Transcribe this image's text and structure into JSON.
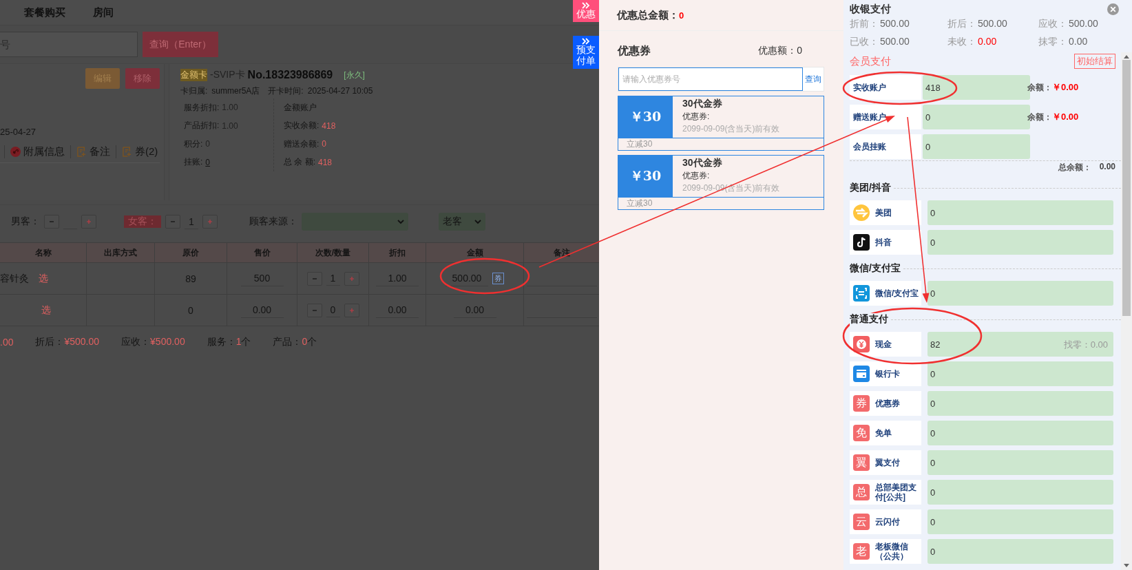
{
  "nav": {
    "items": [
      "套餐购买",
      "房间"
    ]
  },
  "search": {
    "placeholder": "号",
    "button": "查询（Enter）"
  },
  "customer_card": {
    "buttons": [
      "编辑",
      "移除"
    ],
    "date": "25-04-27",
    "links": [
      {
        "kind": "info",
        "label": "附属信息"
      },
      {
        "kind": "note",
        "label": "备注"
      },
      {
        "kind": "coupon",
        "label": "券(2)"
      }
    ]
  },
  "member_card": {
    "card_type": "金额卡",
    "card_name": "-SVIP卡",
    "card_no": "No.18323986869",
    "validity": "[永久]",
    "store_label": "卡归属:",
    "store": "summer5A店",
    "open_label": "开卡时间:",
    "open_time": "2025-04-27 10:05",
    "left": [
      {
        "kind": "plain",
        "label": "服务折扣:",
        "value": "1.00"
      },
      {
        "kind": "plain",
        "label": "产品折扣:",
        "value": "1.00"
      },
      {
        "kind": "plain",
        "label": "积分:",
        "value": "0"
      },
      {
        "kind": "link",
        "label": "挂账:",
        "value": "0"
      }
    ],
    "right_title": "金额账户",
    "right": [
      {
        "label": "实收余额:",
        "value": "418"
      },
      {
        "label": "赠送余额:",
        "value": "0"
      },
      {
        "label": "总 余 额:",
        "value": "418"
      }
    ]
  },
  "guests": {
    "male_label": "男客：",
    "female_label": "女客：",
    "female_count": "1",
    "source_label": "顾客来源：",
    "type_value": "老客"
  },
  "table": {
    "columns": [
      "名称",
      "出库方式",
      "原价",
      "售价",
      "次数/数量",
      "折扣",
      "金额",
      "备注"
    ],
    "rows": [
      {
        "name": "容针灸",
        "pick": "选",
        "original": "89",
        "price": "500",
        "qty": "1",
        "discount": "1.00",
        "amount": "500.00",
        "coupon": "券"
      },
      {
        "pick": "选",
        "original": "0",
        "price": "0.00",
        "qty": "0",
        "discount": "0.00",
        "amount": "0.00"
      }
    ]
  },
  "summary": [
    {
      "value": ".00"
    },
    {
      "label": "折后：",
      "value": "¥500.00"
    },
    {
      "label": "应收：",
      "value": "¥500.00"
    },
    {
      "label": "服务：",
      "value": "1",
      "unit": "个"
    },
    {
      "label": "产品：",
      "value": "0",
      "unit": "个"
    }
  ],
  "side_tabs": [
    {
      "label": "优惠",
      "color": "#ff4f7b"
    },
    {
      "label": "预支付单",
      "color": "#0a5cff"
    }
  ],
  "discount_total": {
    "label": "优惠总金额：",
    "value": "0"
  },
  "coupons": {
    "title": "优惠券",
    "amount_label": "优惠额：",
    "amount": "0",
    "placeholder": "请输入优惠券号",
    "query": "查询",
    "items": [
      {
        "price": "￥30",
        "name": "30代金券",
        "type": "优惠券:",
        "validity": "2099-09-09(含当天)前有效",
        "note": "立减30"
      },
      {
        "price": "￥30",
        "name": "30代金券",
        "type": "优惠券:",
        "validity": "2099-09-09(含当天)前有效",
        "note": "立减30"
      }
    ]
  },
  "checkout": {
    "title": "收银支付",
    "stats": [
      {
        "label": "折前：",
        "value": "500.00",
        "highlight": false
      },
      {
        "label": "折后：",
        "value": "500.00",
        "highlight": false
      },
      {
        "label": "应收：",
        "value": "500.00",
        "highlight": false
      },
      {
        "label": "已收：",
        "value": "500.00",
        "highlight": false
      },
      {
        "label": "未收：",
        "value": "0.00",
        "highlight": true
      },
      {
        "label": "抹零：",
        "value": "0.00",
        "highlight": false
      }
    ],
    "member": {
      "title": "会员支付",
      "reset": "初始结算",
      "accounts": [
        {
          "label": "实收账户",
          "value": "418",
          "balance_label": "余额：",
          "balance": "￥0.00"
        },
        {
          "label": "赠送账户",
          "value": "0",
          "balance_label": "余额：",
          "balance": "￥0.00"
        },
        {
          "label": "会员挂账",
          "value": "0"
        }
      ],
      "total_label": "总余额：",
      "total": "0.00"
    },
    "groups": [
      {
        "title": "美团/抖音",
        "methods": [
          {
            "kind": "meituan",
            "label": "美团",
            "value": "0"
          },
          {
            "kind": "douyin",
            "label": "抖音",
            "value": "0"
          }
        ]
      },
      {
        "title": "微信/支付宝",
        "methods": [
          {
            "kind": "scan",
            "label": "微信/支付宝",
            "value": "0"
          }
        ]
      },
      {
        "title": "普通支付",
        "methods": [
          {
            "kind": "cash",
            "label": "现金",
            "value": "82",
            "change_label": "找零：",
            "change": "0.00"
          },
          {
            "kind": "card",
            "label": "银行卡",
            "value": "0"
          },
          {
            "kind": "glyph",
            "glyph": "券",
            "label": "优惠券",
            "value": "0"
          },
          {
            "kind": "glyph",
            "glyph": "免",
            "label": "免单",
            "value": "0"
          },
          {
            "kind": "glyph",
            "glyph": "翼",
            "label": "翼支付",
            "value": "0"
          },
          {
            "kind": "glyph",
            "glyph": "总",
            "label": "总部美团支付[公共]",
            "value": "0"
          },
          {
            "kind": "glyph",
            "glyph": "云",
            "label": "云闪付",
            "value": "0"
          },
          {
            "kind": "glyph",
            "glyph": "老",
            "label": "老板微信（公共）",
            "value": "0"
          }
        ]
      }
    ]
  }
}
